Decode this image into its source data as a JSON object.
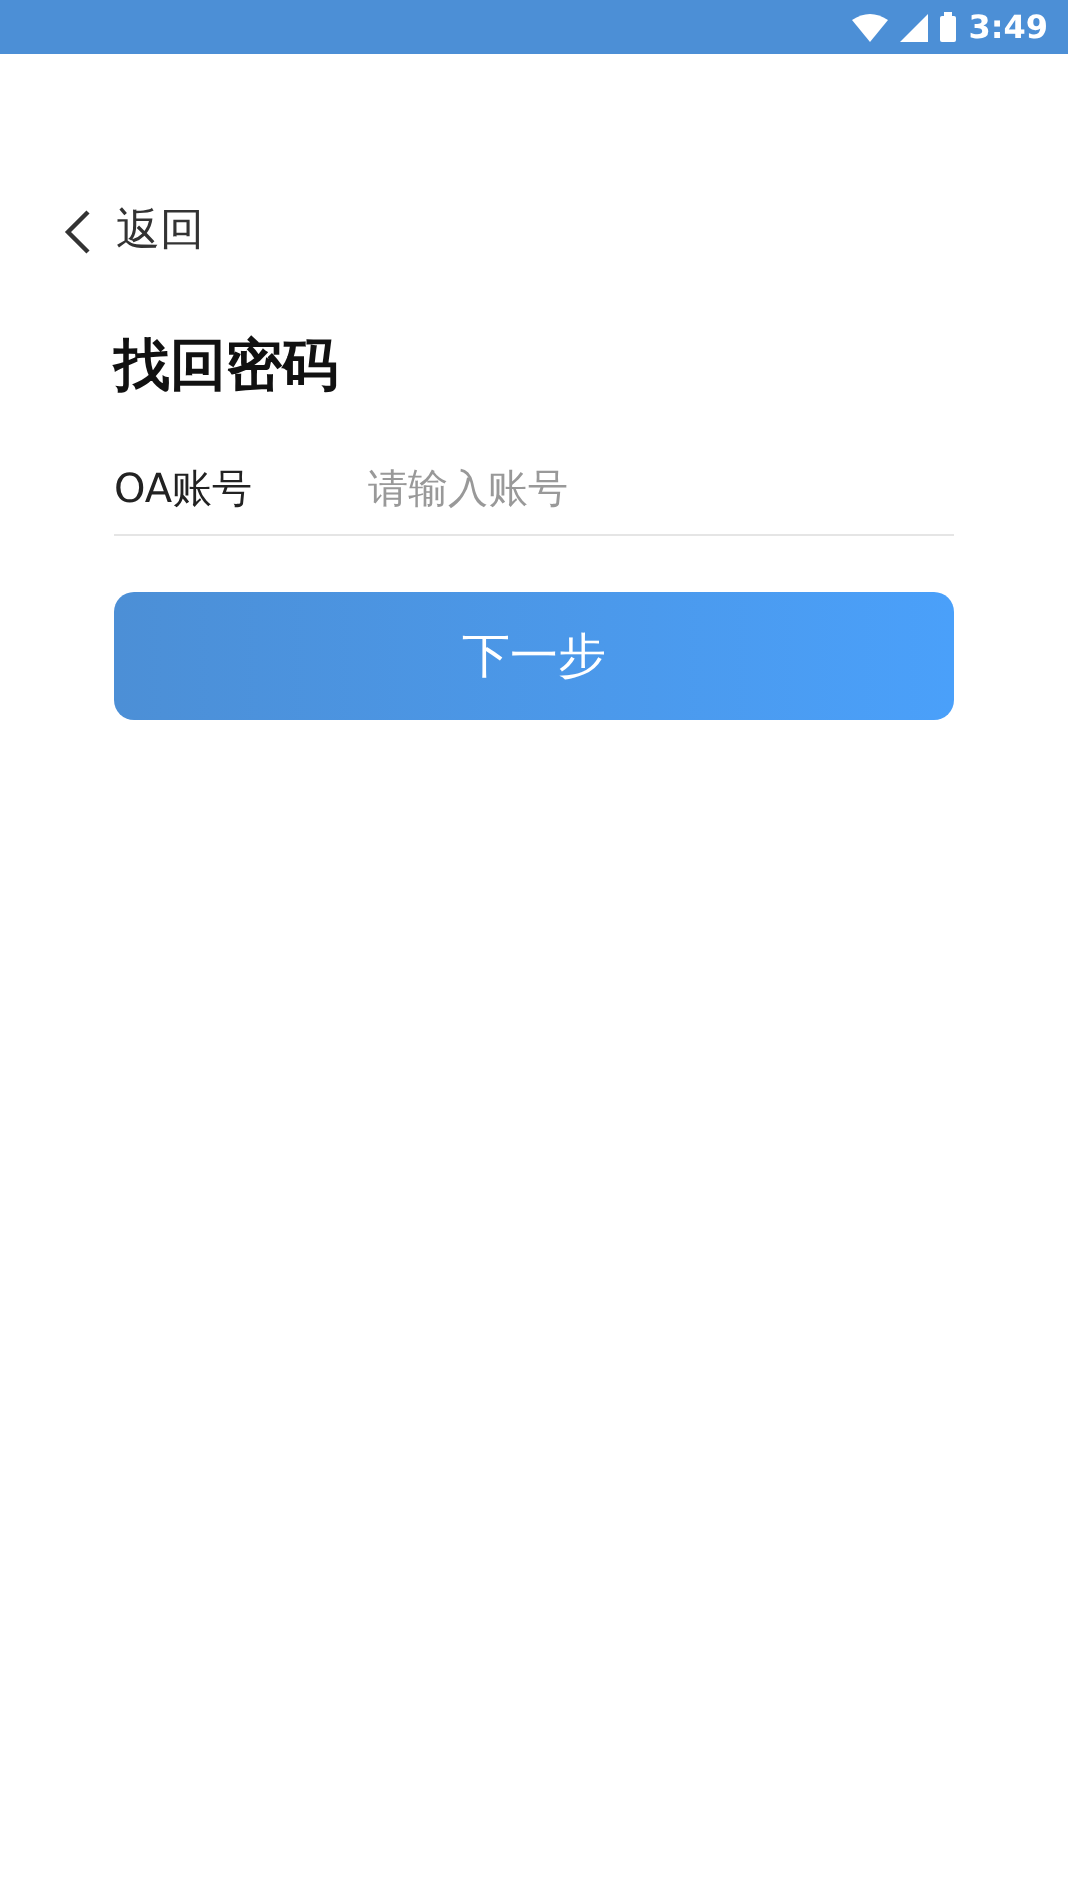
{
  "status_bar": {
    "time": "3:49"
  },
  "back": {
    "label": "返回"
  },
  "title": "找回密码",
  "account_field": {
    "label": "OA账号",
    "placeholder": "请输入账号"
  },
  "next_button": {
    "label": "下一步"
  }
}
